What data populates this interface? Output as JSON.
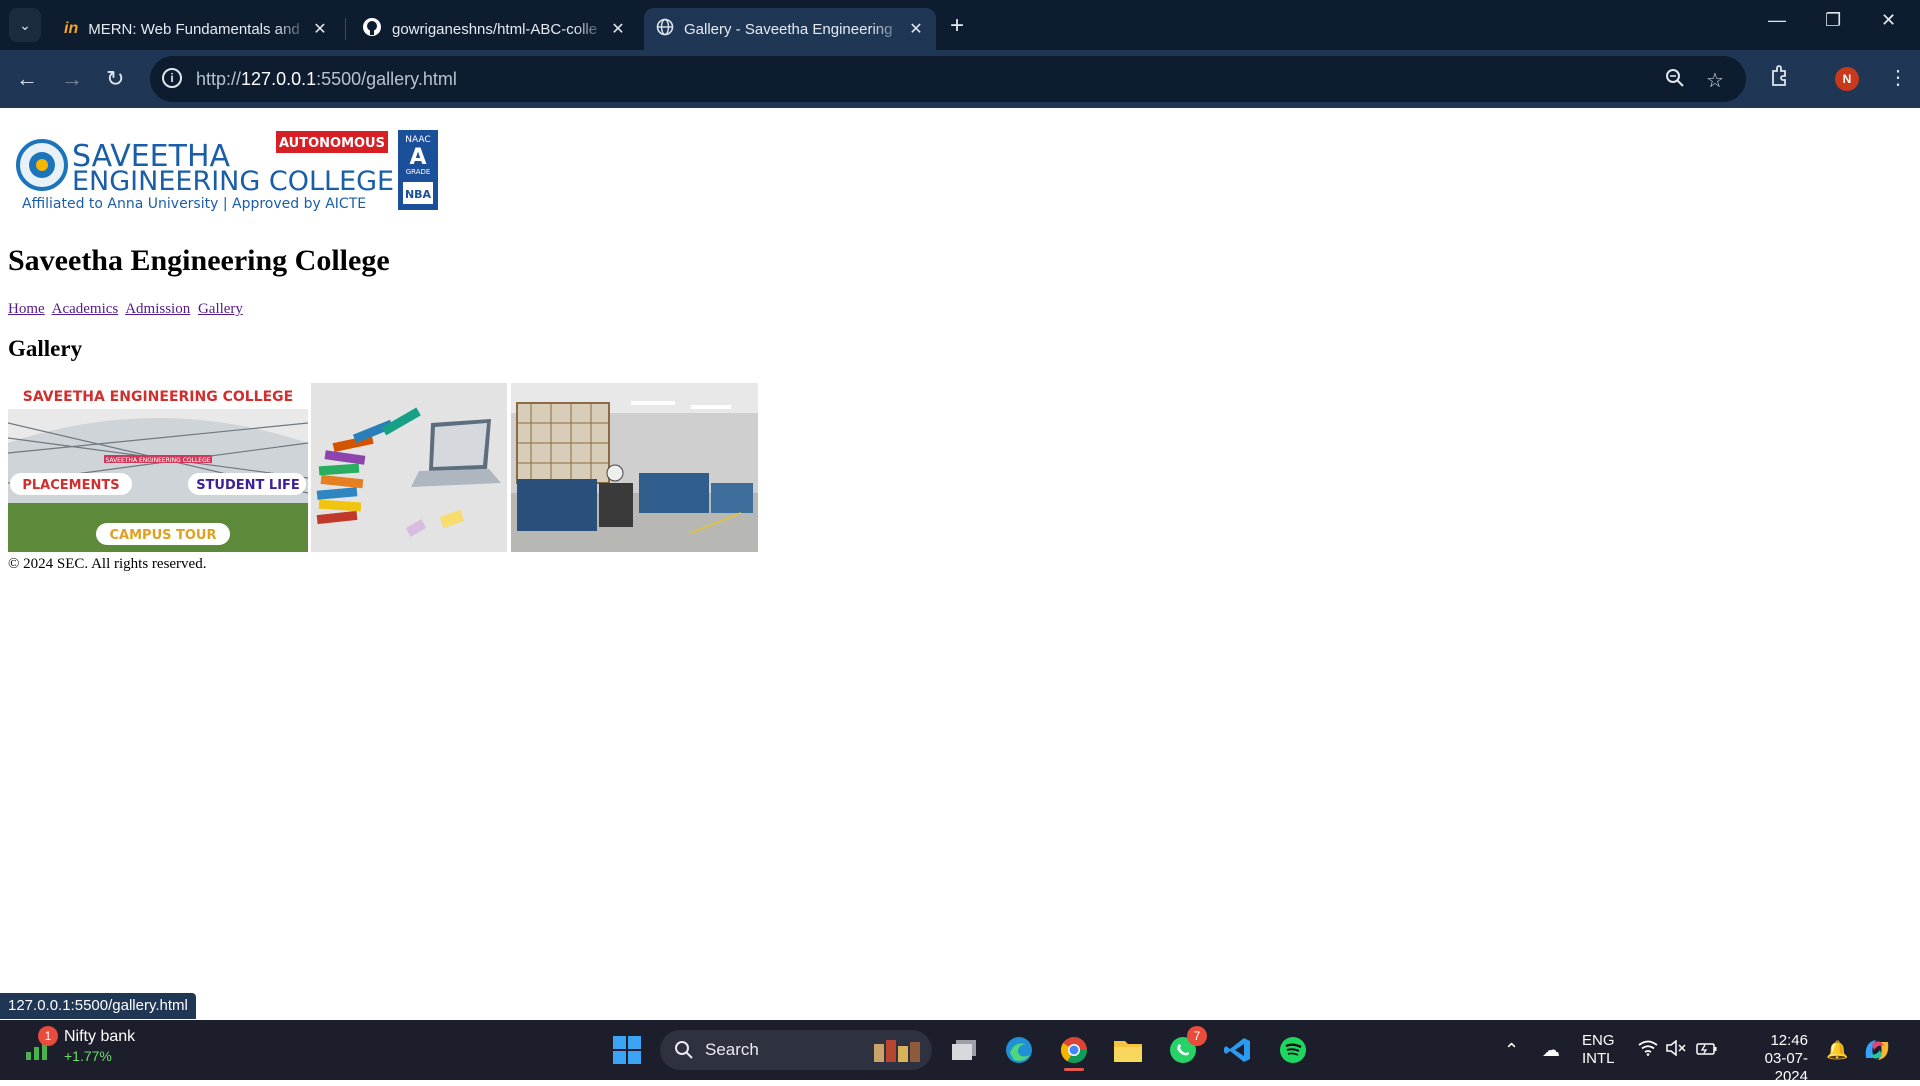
{
  "browser": {
    "tabs": [
      {
        "title": "MERN: Web Fundamentals and",
        "icon": "coursera-icon"
      },
      {
        "title": "gowriganeshns/html-ABC-colle",
        "icon": "github-icon"
      },
      {
        "title": "Gallery - Saveetha Engineering",
        "icon": "globe-icon"
      }
    ],
    "url_scheme": "http://",
    "url_host": "127.0.0.1",
    "url_rest": ":5500/gallery.html",
    "profile_initial": "N"
  },
  "page": {
    "logo": {
      "line1": "SAVEETHA",
      "line2": "ENGINEERING COLLEGE",
      "tagline": "Affiliated to Anna University | Approved by AICTE",
      "badge": "AUTONOMOUS",
      "naac_top": "NAAC",
      "naac_grade": "A",
      "naac_bottom": "GRADE",
      "nba": "NBA"
    },
    "title": "Saveetha Engineering College",
    "nav": [
      "Home",
      "Academics",
      "Admission",
      "Gallery"
    ],
    "gallery_heading": "Gallery",
    "gallery_images": [
      {
        "caption_top": "SAVEETHA ENGINEERING COLLEGE",
        "pill_left": "PLACEMENTS",
        "pill_right": "STUDENT LIFE",
        "pill_bottom": "CAMPUS TOUR",
        "sign": "SAVEETHA ENGINEERING COLLEGE"
      },
      {
        "subject": "books-and-laptop"
      },
      {
        "subject": "engineering-lab"
      }
    ],
    "footer": "© 2024 SEC. All rights reserved."
  },
  "status_url": "127.0.0.1:5500/gallery.html",
  "taskbar": {
    "widget_title": "Nifty bank",
    "widget_change": "+1.77%",
    "widget_badge": "1",
    "search_label": "Search",
    "whatsapp_badge": "7",
    "lang_top": "ENG",
    "lang_bottom": "INTL",
    "time": "12:46",
    "date": "03-07-2024"
  },
  "colors": {
    "chrome_dark": "#0e1c2f",
    "chrome_active": "#1f3655",
    "link": "#551a8b",
    "taskbar": "#1c1f2b"
  }
}
